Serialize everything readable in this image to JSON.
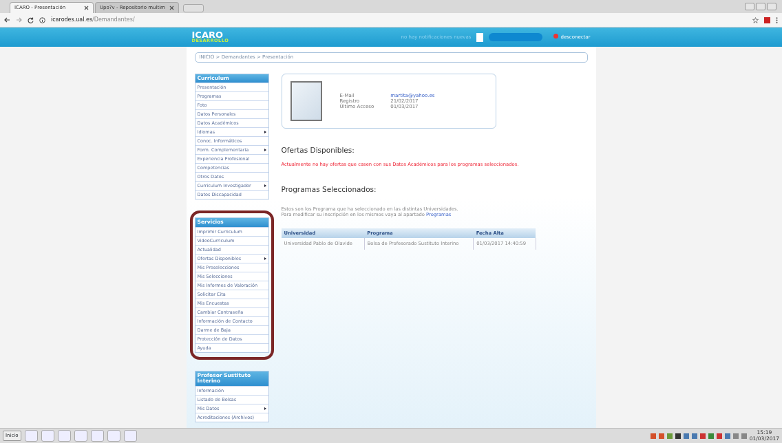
{
  "browser": {
    "tabs": [
      {
        "title": "ICARO - Presentación",
        "selected": true
      },
      {
        "title": "Upo?v - Repositorio multim",
        "selected": false
      }
    ],
    "url_host": "icarodes.ual.es",
    "url_path": "/Demandantes/"
  },
  "header": {
    "logo": "ICARO",
    "logo_sub": "DESARROLLO",
    "notifications": "no hay notificaciones nuevas",
    "logout": "desconectar"
  },
  "breadcrumb": "INICIO > Demandantes > Presentación",
  "sidebar": [
    {
      "title": "Curriculum",
      "highlighted": false,
      "items": [
        {
          "label": "Presentación",
          "has_submenu": false
        },
        {
          "label": "Programas",
          "has_submenu": false
        },
        {
          "label": "Foto",
          "has_submenu": false
        },
        {
          "label": "Datos Personales",
          "has_submenu": false
        },
        {
          "label": "Datos Académicos",
          "has_submenu": false
        },
        {
          "label": "Idiomas",
          "has_submenu": true
        },
        {
          "label": "Conoc. Informáticos",
          "has_submenu": false
        },
        {
          "label": "Form. Complementaria",
          "has_submenu": true
        },
        {
          "label": "Experiencia Profesional",
          "has_submenu": false
        },
        {
          "label": "Competencias",
          "has_submenu": false
        },
        {
          "label": "Otros Datos",
          "has_submenu": false
        },
        {
          "label": "Curriculum Investigador",
          "has_submenu": true
        },
        {
          "label": "Datos Discapacidad",
          "has_submenu": false
        }
      ]
    },
    {
      "title": "Servicios",
      "highlighted": true,
      "items": [
        {
          "label": "Imprimir Curriculum",
          "has_submenu": false
        },
        {
          "label": "VideoCurriculum",
          "has_submenu": false
        },
        {
          "label": "Actualidad",
          "has_submenu": false
        },
        {
          "label": "Ofertas Disponibles",
          "has_submenu": true
        },
        {
          "label": "Mis Preselecciones",
          "has_submenu": false
        },
        {
          "label": "Mis Selecciones",
          "has_submenu": false
        },
        {
          "label": "Mis Informes de Valoración",
          "has_submenu": false
        },
        {
          "label": "Solicitar Cita",
          "has_submenu": false
        },
        {
          "label": "Mis Encuestas",
          "has_submenu": false
        },
        {
          "label": "Cambiar Contraseña",
          "has_submenu": false
        },
        {
          "label": "Información de Contacto",
          "has_submenu": false
        },
        {
          "label": "Darme de Baja",
          "has_submenu": false
        },
        {
          "label": "Protección de Datos",
          "has_submenu": false
        },
        {
          "label": "Ayuda",
          "has_submenu": false
        }
      ]
    },
    {
      "title": "Profesor Sustituto Interino",
      "highlighted": false,
      "items": [
        {
          "label": "Información",
          "has_submenu": false
        },
        {
          "label": "Listado de Bolsas",
          "has_submenu": false
        },
        {
          "label": "Mis Datos",
          "has_submenu": true
        },
        {
          "label": "Acreditaciones (Archivos)",
          "has_submenu": false
        }
      ]
    }
  ],
  "profile": {
    "fields": [
      {
        "label": "E-Mail",
        "value": "martita@yahoo.es",
        "kind": "link"
      },
      {
        "label": "Registro",
        "value": "21/02/2017",
        "kind": "text"
      },
      {
        "label": "Último Acceso",
        "value": "01/03/2017",
        "kind": "text"
      }
    ]
  },
  "offers": {
    "title": "Ofertas Disponibles:",
    "message": "Actualmente no hay ofertas que casen con sus Datos Académicos para los programas seleccionados."
  },
  "programs": {
    "title": "Programas Seleccionados:",
    "intro": "Estos son los Programa que ha seleccionado en las distintas Universidades.",
    "intro2": "Para modificar su inscripción en los mismos vaya al apartado",
    "intro_link": "Programas",
    "table": {
      "columns": [
        "Universidad",
        "Programa",
        "Fecha Alta"
      ],
      "rows": [
        [
          "Universidad Pablo de Olavide",
          "Bolsa de Profesorado Sustituto Interino",
          "01/03/2017 14:40:59"
        ]
      ]
    }
  },
  "taskbar": {
    "start": "Inicio",
    "time": "15:19",
    "date": "01/03/2017"
  }
}
